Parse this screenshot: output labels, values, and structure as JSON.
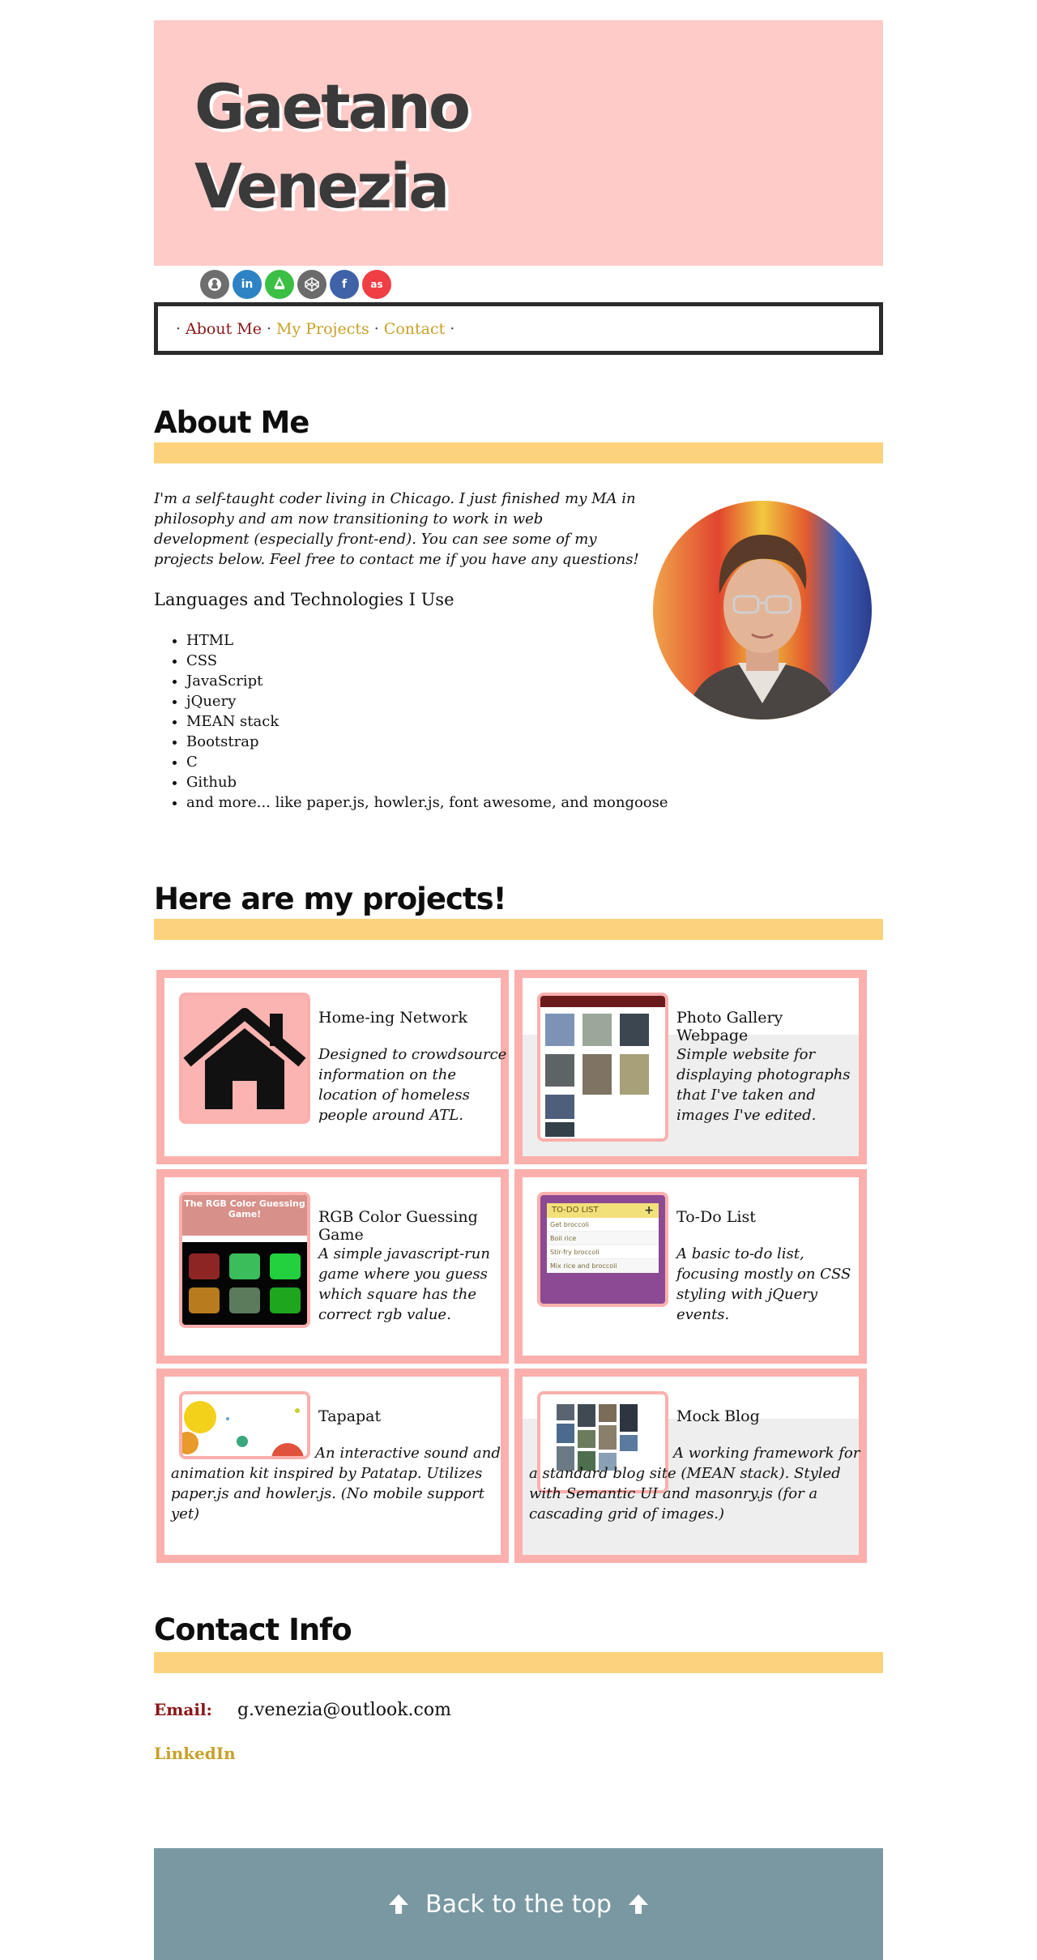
{
  "header": {
    "name_line1": "Gaetano",
    "name_line2": "Venezia",
    "bg": "#fecbc8"
  },
  "socials": [
    {
      "icon": "github-icon",
      "glyph": "◉",
      "color": "#6e6e6e"
    },
    {
      "icon": "linkedin-icon",
      "glyph": "in",
      "color": "#2d83c4"
    },
    {
      "icon": "freecodecamp-icon",
      "glyph": "⌂",
      "color": "#3bbf45"
    },
    {
      "icon": "codepen-icon",
      "glyph": "◈",
      "color": "#6b6b6b"
    },
    {
      "icon": "facebook-icon",
      "glyph": "f",
      "color": "#3f62a8"
    },
    {
      "icon": "lastfm-icon",
      "glyph": "as",
      "color": "#ef3e44"
    }
  ],
  "nav": {
    "about": "About Me",
    "projects": "My Projects",
    "contact": "Contact",
    "sep": "·"
  },
  "about": {
    "heading": "About Me",
    "intro": "I'm a self-taught coder living in Chicago. I just finished my MA in philosophy and am now transitioning to work in web development (especially front-end). You can see some of my projects below. Feel free to contact me if you have any questions!",
    "lang_title": "Languages and Technologies I Use",
    "languages": [
      "HTML",
      "CSS",
      "JavaScript",
      "jQuery",
      "MEAN stack",
      "Bootstrap",
      "C",
      "Github",
      "and more... like paper.js, howler.js, font awesome, and mongoose"
    ]
  },
  "projects": {
    "heading": "Here are my projects!",
    "items": [
      {
        "title": "Home-ing Network",
        "desc": "Designed to crowdsource information on the location of homeless people around ATL."
      },
      {
        "title": "Photo Gallery Webpage",
        "desc": "Simple website for displaying photographs that I've taken and images I've edited."
      },
      {
        "title": "RGB Color Guessing Game",
        "desc": "A simple javascript-run game where you guess which square has the correct rgb value."
      },
      {
        "title": "To-Do List",
        "desc": "A basic to-do list, focusing mostly on CSS styling with jQuery events."
      },
      {
        "title": "Tapapat",
        "desc": "An interactive sound and animation kit inspired by Patatap. Utilizes paper.js and howler.js. (No mobile support yet)"
      },
      {
        "title": "Mock Blog",
        "desc": "A working framework for a standard blog site (MEAN stack). Styled with Semantic UI and masonry.js (for a cascading grid of images.)"
      }
    ],
    "thumb_text": {
      "rgb_title": "The RGB Color Guessing Game!",
      "todo_title": "TO-DO LIST",
      "todo_add": "+",
      "todo_items": [
        "Get broccoli",
        "Boil rice",
        "Stir-fry broccoli",
        "Mix rice and broccoli"
      ]
    }
  },
  "contact": {
    "heading": "Contact Info",
    "email_label": "Email:",
    "email": "g.venezia@outlook.com",
    "linkedin": "LinkedIn"
  },
  "footer": {
    "back_top": "Back to the top"
  },
  "colors": {
    "accent_bar": "#fdd27c",
    "link_dark": "#8a1616",
    "link_gold": "#c8a02a",
    "card_border": "#fbb0ad",
    "footer_bg": "#7a98a1"
  }
}
